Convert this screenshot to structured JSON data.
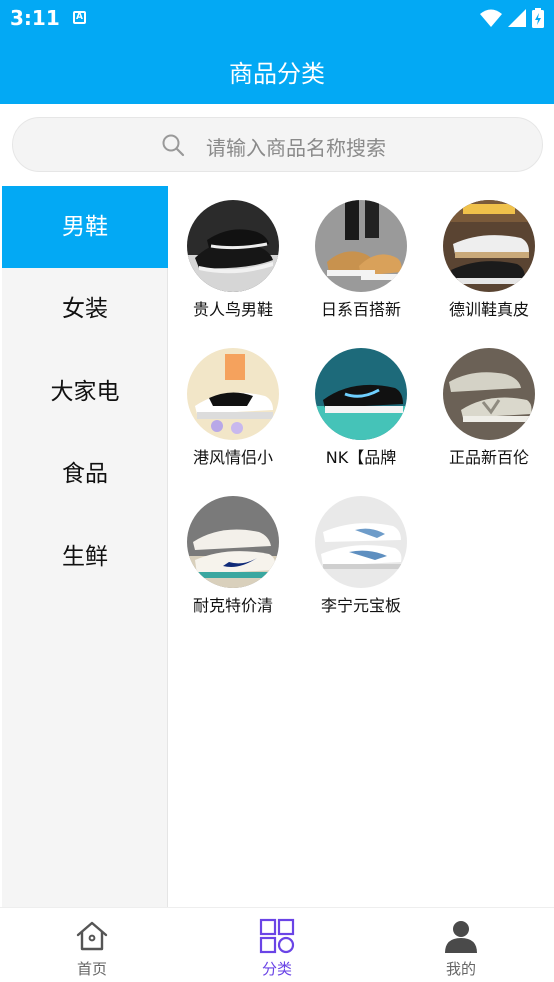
{
  "status_bar": {
    "time": "3:11",
    "notification_letter": "A",
    "icons": [
      "wifi-icon",
      "cell-signal-icon",
      "battery-icon"
    ]
  },
  "header": {
    "title": "商品分类"
  },
  "search": {
    "placeholder": "请输入商品名称搜索",
    "icon": "search-icon"
  },
  "sidebar": {
    "items": [
      {
        "label": "男鞋",
        "active": true
      },
      {
        "label": "女装",
        "active": false
      },
      {
        "label": "大家电",
        "active": false
      },
      {
        "label": "食品",
        "active": false
      },
      {
        "label": "生鲜",
        "active": false
      }
    ]
  },
  "products": [
    {
      "label": "贵人鸟男鞋"
    },
    {
      "label": "日系百搭新"
    },
    {
      "label": "德训鞋真皮"
    },
    {
      "label": "港风情侣小"
    },
    {
      "label": "NK【品牌"
    },
    {
      "label": "正品新百伦"
    },
    {
      "label": "耐克特价清"
    },
    {
      "label": "李宁元宝板"
    }
  ],
  "bottom_nav": {
    "items": [
      {
        "label": "首页",
        "icon": "home-icon",
        "active": false
      },
      {
        "label": "分类",
        "icon": "category-grid-icon",
        "active": true
      },
      {
        "label": "我的",
        "icon": "person-icon",
        "active": false
      }
    ]
  },
  "colors": {
    "primary": "#03a9f4",
    "nav_active": "#6a44e6"
  }
}
